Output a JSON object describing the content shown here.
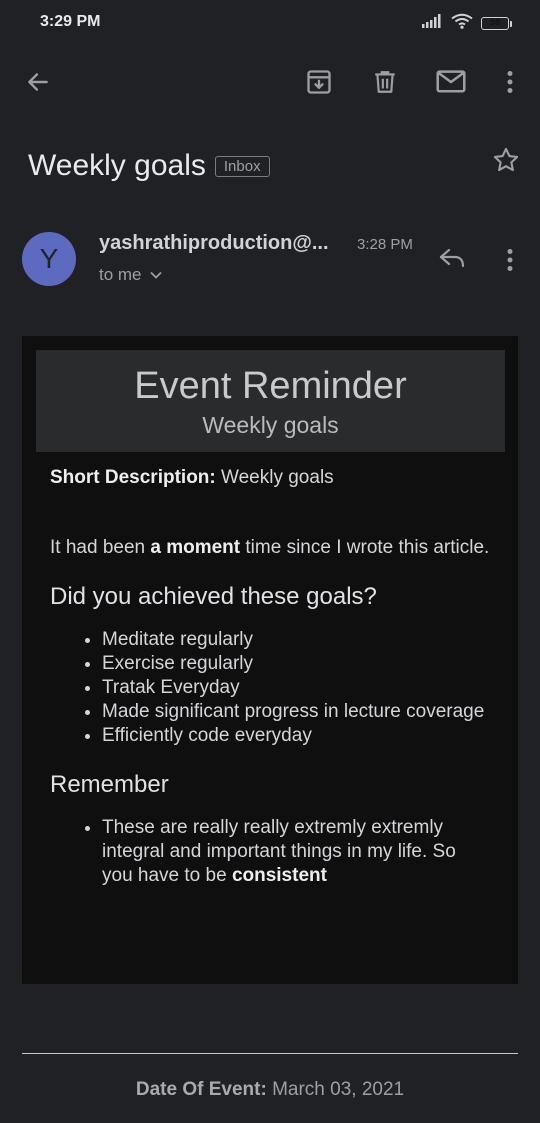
{
  "status_bar": {
    "time": "3:29 PM",
    "battery": "58"
  },
  "email": {
    "subject": "Weekly goals",
    "label": "Inbox",
    "sender": {
      "initial": "Y",
      "name": "yashrathiproduction@...",
      "time": "3:28 PM",
      "recipient": "to me"
    },
    "banner": {
      "title": "Event Reminder",
      "subtitle": "Weekly goals"
    },
    "body": {
      "short_desc_label": "Short Description:",
      "short_desc_value": " Weekly goals",
      "intro_before": "It had been ",
      "intro_bold": "a moment",
      "intro_after": " time since I wrote this article.",
      "goals_heading": "Did you achieved these goals?",
      "goals": [
        "Meditate regularly",
        "Exercise regularly",
        "Tratak Everyday",
        "Made significant progress in lecture coverage",
        "Efficiently code everyday"
      ],
      "remember_heading": "Remember",
      "remember_before": "These are really really extremly extremly integral and important things in my life. So you have to be ",
      "remember_bold": "consistent"
    },
    "footer": {
      "date_label": "Date Of Event:",
      "date_value": " March 03, 2021"
    }
  }
}
